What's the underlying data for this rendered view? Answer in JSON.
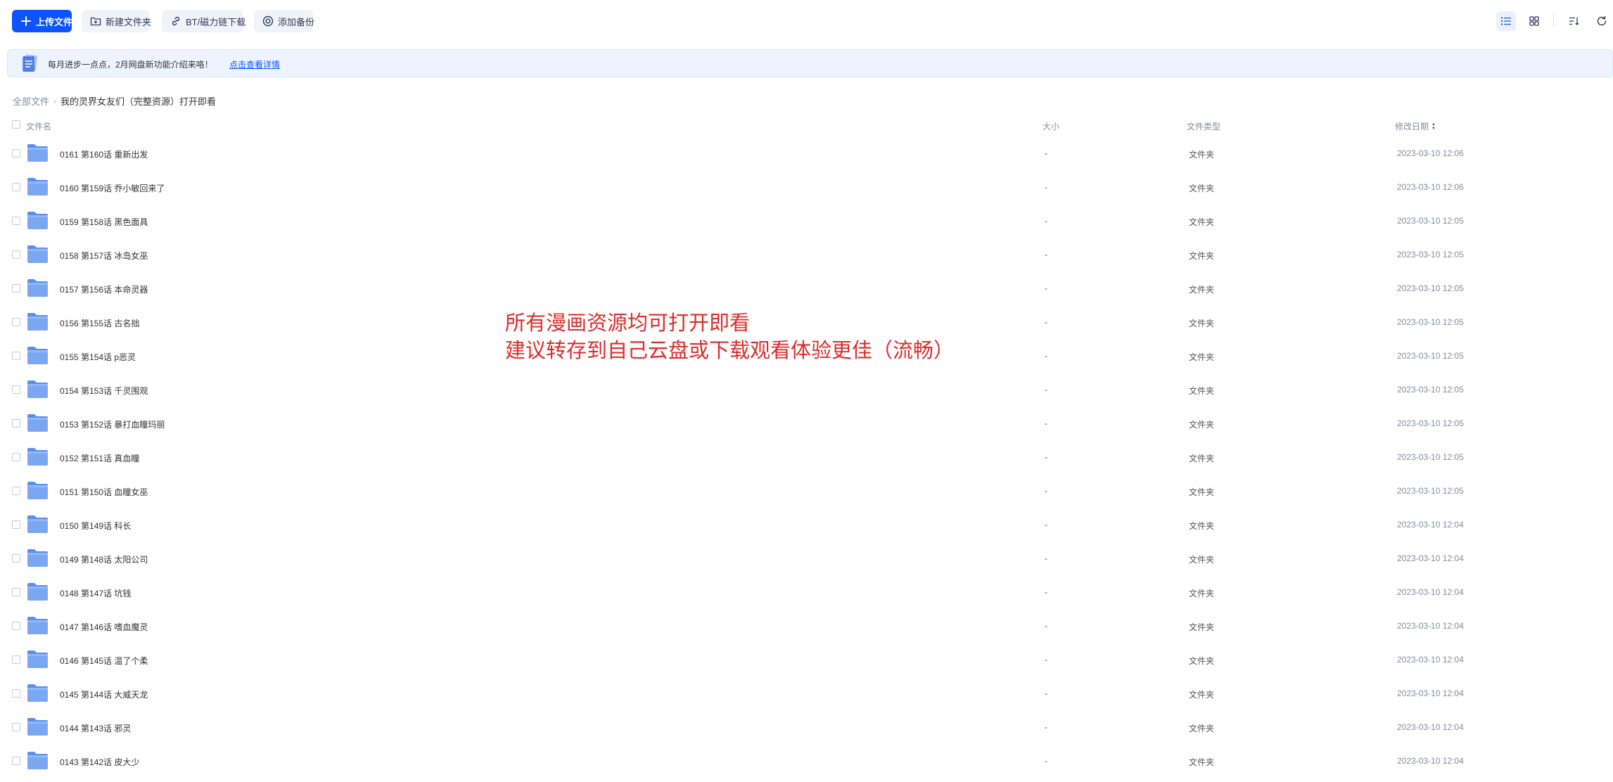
{
  "toolbar": {
    "upload_label": "上传文件",
    "new_folder_label": "新建文件夹",
    "bt_label": "BT/磁力链下载",
    "backup_label": "添加备份"
  },
  "banner": {
    "text": "每月进步一点点，2月网盘新功能介绍来咯！",
    "link": "点击查看详情"
  },
  "breadcrumb": {
    "root": "全部文件",
    "current": "我的灵界女友们（完整资源）打开即看"
  },
  "columns": {
    "name": "文件名",
    "size": "大小",
    "type": "文件类型",
    "date": "修改日期"
  },
  "files": [
    {
      "name": "0161 第160话 重新出发",
      "size": "-",
      "type": "文件夹",
      "date": "2023-03-10 12:06"
    },
    {
      "name": "0160 第159话 乔小敏回来了",
      "size": "-",
      "type": "文件夹",
      "date": "2023-03-10 12:06"
    },
    {
      "name": "0159 第158话 黑色面具",
      "size": "-",
      "type": "文件夹",
      "date": "2023-03-10 12:05"
    },
    {
      "name": "0158 第157话 冰岛女巫",
      "size": "-",
      "type": "文件夹",
      "date": "2023-03-10 12:05"
    },
    {
      "name": "0157 第156话 本命灵器",
      "size": "-",
      "type": "文件夹",
      "date": "2023-03-10 12:05"
    },
    {
      "name": "0156 第155话 古名拙",
      "size": "-",
      "type": "文件夹",
      "date": "2023-03-10 12:05"
    },
    {
      "name": "0155 第154话 p恶灵",
      "size": "-",
      "type": "文件夹",
      "date": "2023-03-10 12:05"
    },
    {
      "name": "0154 第153话 千灵围观",
      "size": "-",
      "type": "文件夹",
      "date": "2023-03-10 12:05"
    },
    {
      "name": "0153 第152话 暴打血瞳玛丽",
      "size": "-",
      "type": "文件夹",
      "date": "2023-03-10 12:05"
    },
    {
      "name": "0152 第151话 真血瞳",
      "size": "-",
      "type": "文件夹",
      "date": "2023-03-10 12:05"
    },
    {
      "name": "0151 第150话 血瞳女巫",
      "size": "-",
      "type": "文件夹",
      "date": "2023-03-10 12:05"
    },
    {
      "name": "0150 第149话 科长",
      "size": "-",
      "type": "文件夹",
      "date": "2023-03-10 12:04"
    },
    {
      "name": "0149 第148话 太阳公司",
      "size": "-",
      "type": "文件夹",
      "date": "2023-03-10 12:04"
    },
    {
      "name": "0148 第147话 坑钱",
      "size": "-",
      "type": "文件夹",
      "date": "2023-03-10 12:04"
    },
    {
      "name": "0147 第146话 嗜血魔灵",
      "size": "-",
      "type": "文件夹",
      "date": "2023-03-10 12:04"
    },
    {
      "name": "0146 第145话 温了个柔",
      "size": "-",
      "type": "文件夹",
      "date": "2023-03-10 12:04"
    },
    {
      "name": "0145 第144话 大威天龙",
      "size": "-",
      "type": "文件夹",
      "date": "2023-03-10 12:04"
    },
    {
      "name": "0144 第143话 邪灵",
      "size": "-",
      "type": "文件夹",
      "date": "2023-03-10 12:04"
    },
    {
      "name": "0143 第142话 皮大少",
      "size": "-",
      "type": "文件夹",
      "date": "2023-03-10 12:04"
    }
  ],
  "overlay": {
    "line1": "所有漫画资源均可打开即看",
    "line2": "建议转存到自己云盘或下载观看体验更佳（流畅）"
  },
  "icons": {
    "upload": "plus-icon",
    "new_folder": "folder-plus-icon",
    "bt": "link-icon",
    "backup": "backup-icon",
    "list_view": "list-view-icon",
    "grid_view": "grid-view-icon",
    "sort": "sort-icon",
    "refresh": "refresh-icon",
    "folder": "folder-icon",
    "banner": "notebook-icon"
  },
  "colors": {
    "primary": "#0d53ff",
    "banner_bg": "#eef4ff",
    "folder": "#7ba7f2",
    "overlay_text": "#e22a2a"
  }
}
